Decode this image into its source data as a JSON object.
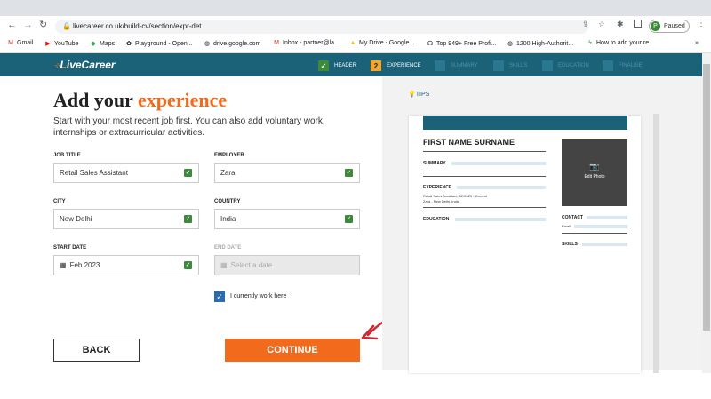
{
  "browser": {
    "url": "livecareer.co.uk/build-cv/section/expr-det",
    "profile_initial": "P",
    "profile_status": "Paused",
    "bookmarks": [
      "Gmail",
      "YouTube",
      "Maps",
      "Playground - Open...",
      "drive.google.com",
      "Inbox - partner@la...",
      "My Drive - Google...",
      "Top 949+ Free Profi...",
      "1200 High-Authorit...",
      "How to add your re..."
    ],
    "more_bookmarks": "»"
  },
  "nav": {
    "logo": "LiveCareer",
    "steps": [
      {
        "num": "✓",
        "label": "HEADER"
      },
      {
        "num": "2",
        "label": "EXPERIENCE"
      },
      {
        "num": "",
        "label": "SUMMARY"
      },
      {
        "num": "",
        "label": "SKILLS"
      },
      {
        "num": "",
        "label": "EDUCATION"
      },
      {
        "num": "",
        "label": "FINALISE"
      }
    ]
  },
  "form": {
    "title_a": "Add your ",
    "title_b": "experience",
    "subtitle": "Start with your most recent job first. You can also add voluntary work, internships or extracurricular activities.",
    "job_title_label": "JOB TITLE",
    "job_title": "Retail Sales Assistant",
    "employer_label": "EMPLOYER",
    "employer": "Zara",
    "city_label": "CITY",
    "city": "New Delhi",
    "country_label": "COUNTRY",
    "country": "India",
    "start_label": "START DATE",
    "start_date": "Feb 2023",
    "end_label": "END DATE",
    "end_placeholder": "Select a date",
    "current_label": "I currently work here",
    "back": "BACK",
    "continue": "CONTINUE"
  },
  "preview": {
    "tips": "TIPS",
    "name": "FIRST NAME SURNAME",
    "summary": "SUMMARY",
    "experience": "EXPERIENCE",
    "exp_line1": "Retail Sales Assistant, 02/2023 - Current",
    "exp_line2": "Zara - New Delhi, India",
    "education": "EDUCATION",
    "edit_photo": "Edit Photo",
    "contact": "CONTACT",
    "email": "Email: ",
    "skills": "SKILLS"
  },
  "colors": {
    "brand": "#1b6178",
    "accent": "#f26b1d",
    "check": "#3c8a3a"
  }
}
